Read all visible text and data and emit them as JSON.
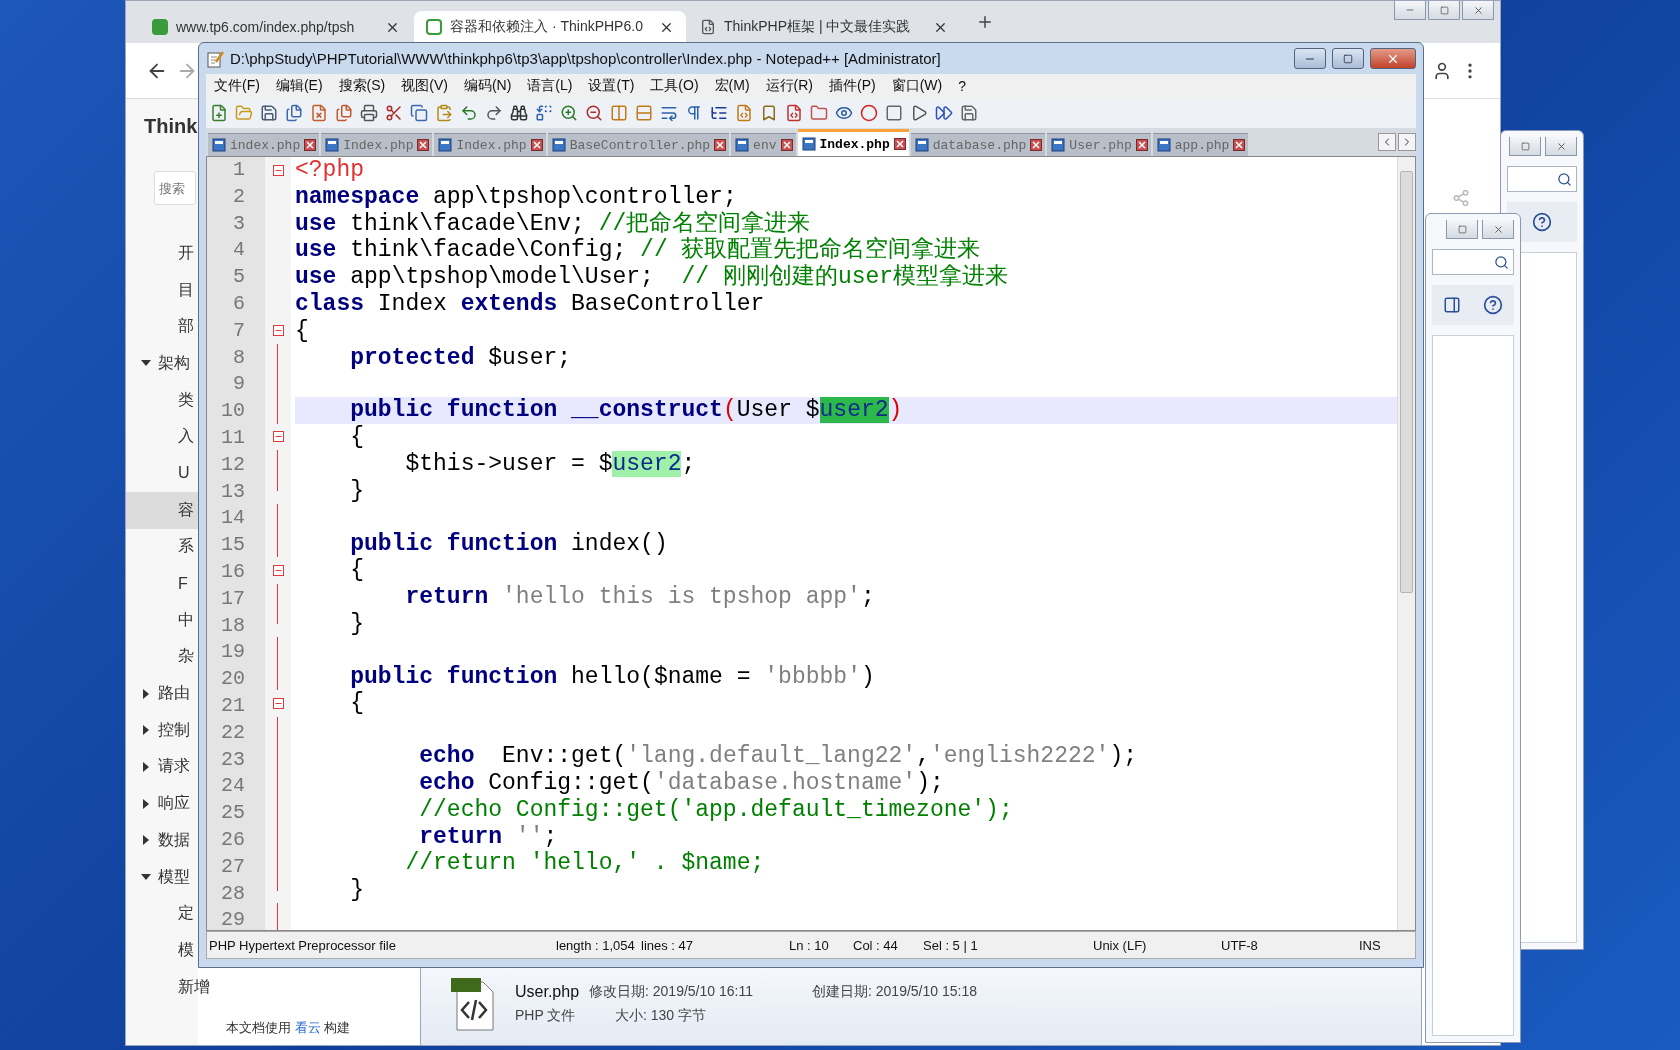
{
  "browser": {
    "tabs": [
      {
        "label": "www.tp6.com/index.php/tpsh",
        "selected": false
      },
      {
        "label": "容器和依赖注入 · ThinkPHP6.0",
        "selected": true
      },
      {
        "label": "ThinkPHP框架 | 中文最佳实践",
        "selected": false
      }
    ],
    "sidebar": {
      "title": "Think",
      "search": {
        "placeholder": "搜索"
      },
      "items": [
        {
          "label": "开",
          "selected": false
        },
        {
          "label": "目",
          "selected": false
        },
        {
          "label": "部",
          "selected": false
        },
        {
          "label": "架构",
          "selected": false,
          "expanded": true,
          "children": [
            {
              "label": "类",
              "selected": false
            },
            {
              "label": "入",
              "selected": false
            },
            {
              "label": "U",
              "selected": false
            },
            {
              "label": "容",
              "selected": true
            },
            {
              "label": "系",
              "selected": false
            },
            {
              "label": "F",
              "selected": false
            },
            {
              "label": "中",
              "selected": false
            },
            {
              "label": "杂",
              "selected": false
            }
          ]
        },
        {
          "label": "路由",
          "selected": false,
          "expanded": false
        },
        {
          "label": "控制",
          "selected": false,
          "expanded": false
        },
        {
          "label": "请求",
          "selected": false,
          "expanded": false
        },
        {
          "label": "响应",
          "selected": false,
          "expanded": false
        },
        {
          "label": "数据",
          "selected": false,
          "expanded": false
        },
        {
          "label": "模型",
          "selected": false,
          "expanded": true,
          "children": [
            {
              "label": "定",
              "selected": false
            },
            {
              "label": "模",
              "selected": false
            },
            {
              "label": "新增",
              "selected": false
            }
          ]
        }
      ]
    },
    "footer": {
      "before": "本文档使用",
      "link": "看云",
      "after": "构建"
    }
  },
  "notepad": {
    "title": "D:\\phpStudy\\PHPTutorial\\WWW\\thinkphp6\\tp3\\app\\tpshop\\controller\\Index.php - Notepad++ [Administrator]",
    "menu": [
      "文件(F)",
      "编辑(E)",
      "搜索(S)",
      "视图(V)",
      "编码(N)",
      "语言(L)",
      "设置(T)",
      "工具(O)",
      "宏(M)",
      "运行(R)",
      "插件(P)",
      "窗口(W)",
      "?"
    ],
    "tabs": [
      {
        "label": "index.php",
        "selected": false
      },
      {
        "label": "Index.php",
        "selected": false
      },
      {
        "label": "Index.php",
        "selected": false
      },
      {
        "label": "BaseController.php",
        "selected": false
      },
      {
        "label": "env",
        "selected": false
      },
      {
        "label": "Index.php",
        "selected": true
      },
      {
        "label": "database.php",
        "selected": false
      },
      {
        "label": "User.php",
        "selected": false
      },
      {
        "label": "app.php",
        "selected": false
      }
    ],
    "lines": [
      {
        "number": "1",
        "kind": "fold-start",
        "current": false,
        "tokens": [
          {
            "text": "<?php",
            "kind": "tag"
          }
        ]
      },
      {
        "number": "2",
        "kind": "none",
        "current": false,
        "tokens": [
          {
            "text": "namespace",
            "kind": "keyword"
          },
          {
            "text": " app\\tpshop\\controller;",
            "kind": "plain"
          }
        ]
      },
      {
        "number": "3",
        "kind": "none",
        "current": false,
        "tokens": [
          {
            "text": "use",
            "kind": "keyword"
          },
          {
            "text": " think\\facade\\Env; ",
            "kind": "plain"
          },
          {
            "text": "//把命名空间拿进来",
            "kind": "comment"
          }
        ]
      },
      {
        "number": "4",
        "kind": "none",
        "current": false,
        "tokens": [
          {
            "text": "use",
            "kind": "keyword"
          },
          {
            "text": " think\\facade\\Config; ",
            "kind": "plain"
          },
          {
            "text": "// 获取配置先把命名空间拿进来",
            "kind": "comment"
          }
        ]
      },
      {
        "number": "5",
        "kind": "none",
        "current": false,
        "tokens": [
          {
            "text": "use",
            "kind": "keyword"
          },
          {
            "text": " app\\tpshop\\model\\User;  ",
            "kind": "plain"
          },
          {
            "text": "// 刚刚创建的user模型拿进来",
            "kind": "comment"
          }
        ]
      },
      {
        "number": "6",
        "kind": "none",
        "current": false,
        "tokens": [
          {
            "text": "class",
            "kind": "keyword"
          },
          {
            "text": " Index ",
            "kind": "plain"
          },
          {
            "text": "extends",
            "kind": "keyword"
          },
          {
            "text": " BaseController",
            "kind": "plain"
          }
        ]
      },
      {
        "number": "7",
        "kind": "fold-start",
        "current": false,
        "tokens": [
          {
            "text": "{",
            "kind": "plain"
          }
        ]
      },
      {
        "number": "8",
        "kind": "fold-body",
        "current": false,
        "tokens": [
          {
            "text": "    protected",
            "kind": "keyword"
          },
          {
            "text": " $user;",
            "kind": "plain"
          }
        ]
      },
      {
        "number": "9",
        "kind": "fold-body"
      },
      {
        "number": "10",
        "kind": "fold-body",
        "current": true,
        "tokens": [
          {
            "text": "    public",
            "kind": "keyword"
          },
          {
            "text": " function",
            "kind": "keyword"
          },
          {
            "text": " __construct",
            "kind": "keyword"
          },
          {
            "text": "(",
            "kind": "brace"
          },
          {
            "text": "User $",
            "kind": "plain"
          },
          {
            "text": "user2",
            "kind": "match"
          },
          {
            "text": ")",
            "kind": "brace"
          }
        ]
      },
      {
        "number": "11",
        "kind": "fold-start",
        "current": false,
        "tokens": [
          {
            "text": "    {",
            "kind": "plain"
          }
        ]
      },
      {
        "number": "12",
        "kind": "fold-body",
        "current": false,
        "tokens": [
          {
            "text": "        $this->user = $",
            "kind": "plain"
          },
          {
            "text": "user2",
            "kind": "match-soft"
          },
          {
            "text": ";",
            "kind": "plain"
          }
        ]
      },
      {
        "number": "13",
        "kind": "fold-end",
        "current": false,
        "tokens": [
          {
            "text": "    }",
            "kind": "plain"
          }
        ]
      },
      {
        "number": "14",
        "kind": "fold-body"
      },
      {
        "number": "15",
        "kind": "fold-body",
        "current": false,
        "tokens": [
          {
            "text": "    public",
            "kind": "keyword"
          },
          {
            "text": " function",
            "kind": "keyword"
          },
          {
            "text": " index()",
            "kind": "plain"
          }
        ]
      },
      {
        "number": "16",
        "kind": "fold-start",
        "current": false,
        "tokens": [
          {
            "text": "    {",
            "kind": "plain"
          }
        ]
      },
      {
        "number": "17",
        "kind": "fold-body",
        "current": false,
        "tokens": [
          {
            "text": "        return",
            "kind": "keyword"
          },
          {
            "text": " 'hello this is tpshop app'",
            "kind": "string"
          },
          {
            "text": ";",
            "kind": "plain"
          }
        ]
      },
      {
        "number": "18",
        "kind": "fold-end",
        "current": false,
        "tokens": [
          {
            "text": "    }",
            "kind": "plain"
          }
        ]
      },
      {
        "number": "19",
        "kind": "fold-body"
      },
      {
        "number": "20",
        "kind": "fold-body",
        "current": false,
        "tokens": [
          {
            "text": "    public",
            "kind": "keyword"
          },
          {
            "text": " function",
            "kind": "keyword"
          },
          {
            "text": " hello($name = ",
            "kind": "plain"
          },
          {
            "text": "'bbbbb'",
            "kind": "string"
          },
          {
            "text": ")",
            "kind": "plain"
          }
        ]
      },
      {
        "number": "21",
        "kind": "fold-start",
        "current": false,
        "tokens": [
          {
            "text": "    {",
            "kind": "plain"
          }
        ]
      },
      {
        "number": "22",
        "kind": "fold-body"
      },
      {
        "number": "23",
        "kind": "fold-body",
        "current": false,
        "tokens": [
          {
            "text": "         echo",
            "kind": "keyword"
          },
          {
            "text": "  Env::get(",
            "kind": "plain"
          },
          {
            "text": "'lang.default_lang22'",
            "kind": "string"
          },
          {
            "text": ",",
            "kind": "plain"
          },
          {
            "text": "'english2222'",
            "kind": "string"
          },
          {
            "text": ");",
            "kind": "plain"
          }
        ]
      },
      {
        "number": "24",
        "kind": "fold-body",
        "current": false,
        "tokens": [
          {
            "text": "         echo",
            "kind": "keyword"
          },
          {
            "text": " Config::get(",
            "kind": "plain"
          },
          {
            "text": "'database.hostname'",
            "kind": "string"
          },
          {
            "text": ");",
            "kind": "plain"
          }
        ]
      },
      {
        "number": "25",
        "kind": "fold-body",
        "current": false,
        "tokens": [
          {
            "text": "         //echo Config::get('app.default_timezone');",
            "kind": "comment"
          }
        ]
      },
      {
        "number": "26",
        "kind": "fold-body",
        "current": false,
        "tokens": [
          {
            "text": "         return",
            "kind": "keyword"
          },
          {
            "text": " ''",
            "kind": "string"
          },
          {
            "text": ";",
            "kind": "plain"
          }
        ]
      },
      {
        "number": "27",
        "kind": "fold-body",
        "current": false,
        "tokens": [
          {
            "text": "        //return 'hello,' . $name;",
            "kind": "comment"
          }
        ]
      },
      {
        "number": "28",
        "kind": "fold-end",
        "current": false,
        "tokens": [
          {
            "text": "    }",
            "kind": "plain"
          }
        ]
      },
      {
        "number": "29",
        "kind": "fold-body"
      }
    ],
    "status_bar": [
      "PHP Hypertext Preprocessor file",
      "length : 1,054",
      "lines : 47",
      "Ln : 10",
      "Col : 44",
      "Sel : 5 | 1",
      "Unix (LF)",
      "UTF-8",
      "INS"
    ]
  },
  "explorer_details": {
    "name": "User.php",
    "modified": "修改日期: 2019/5/10 16:11",
    "created": "创建日期: 2019/5/10 15:18",
    "type": "PHP 文件",
    "size": "大小: 130 字节"
  }
}
